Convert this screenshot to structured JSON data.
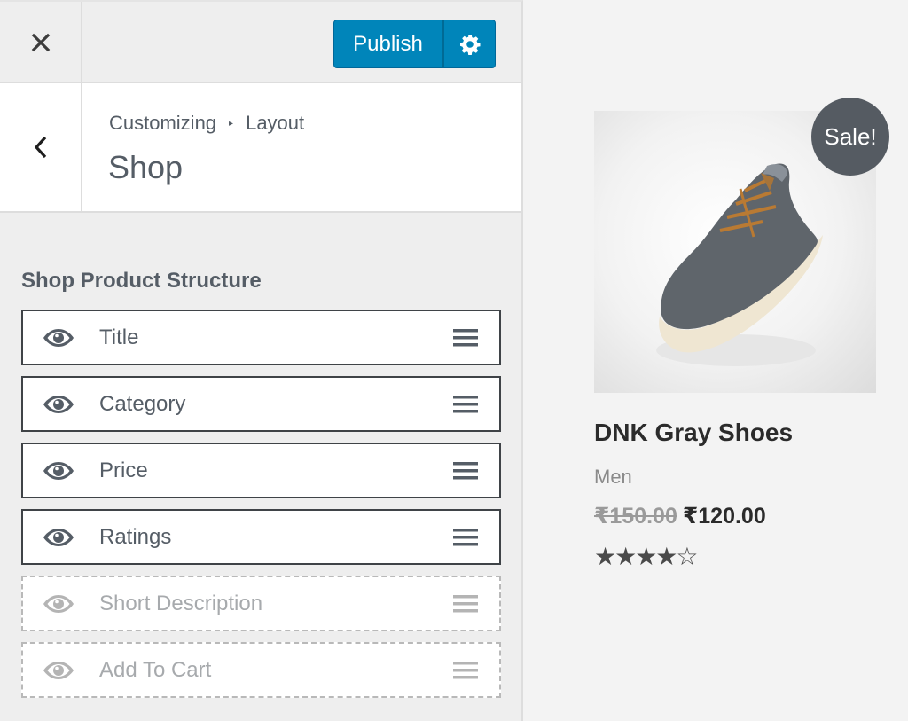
{
  "header": {
    "close_icon": "close-icon",
    "publish_label": "Publish",
    "settings_icon": "gear-icon",
    "accent_color": "#0085ba"
  },
  "section": {
    "back_icon": "chevron-left-icon",
    "breadcrumb": [
      "Customizing",
      "Layout"
    ],
    "breadcrumb_separator": "▸",
    "title": "Shop"
  },
  "control": {
    "title": "Shop Product Structure",
    "items": [
      {
        "label": "Title",
        "visible": true
      },
      {
        "label": "Category",
        "visible": true
      },
      {
        "label": "Price",
        "visible": true
      },
      {
        "label": "Ratings",
        "visible": true
      },
      {
        "label": "Short Description",
        "visible": false
      },
      {
        "label": "Add To Cart",
        "visible": false
      }
    ]
  },
  "preview": {
    "badge": "Sale!",
    "product_title": "DNK Gray Shoes",
    "category": "Men",
    "price_old": "₹150.00",
    "price_new": "₹120.00",
    "rating": 4,
    "rating_max": 5,
    "stars_filled": "★★★★",
    "stars_empty": "☆"
  }
}
